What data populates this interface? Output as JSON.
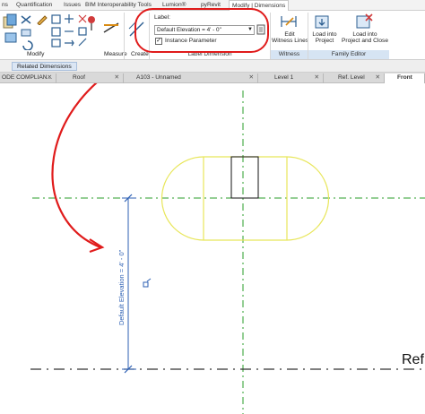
{
  "ribbon_tabs": [
    {
      "label": "ns"
    },
    {
      "label": "Quantification"
    },
    {
      "label": "Issues"
    },
    {
      "label": "BIM Interoperability Tools"
    },
    {
      "label": "Lumion®"
    },
    {
      "label": "pyRevit"
    },
    {
      "label": "Modify | Dimensions"
    }
  ],
  "ribbon": {
    "modify_label": "Modify",
    "measure_label": "Measure",
    "create_label": "Create",
    "label_caption": "Label:",
    "label_dimension_panel": "Label Dimension",
    "label_value": "Default Elevation = 4' - 0\"",
    "instance_parameter": "Instance Parameter",
    "edit_witness_line1": "Edit",
    "edit_witness_line2": "Witness Lines",
    "witness_lines_panel": "Witness Lines",
    "load_project_line1": "Load into",
    "load_project_line2": "Project",
    "load_close_line1": "Load into",
    "load_close_line2": "Project and Close",
    "family_editor_panel": "Family Editor",
    "check_mark": "✓"
  },
  "subbar": {
    "related_dimensions": "Related Dimensions"
  },
  "view_tabs": [
    {
      "label": "ODE COMPLIAN..."
    },
    {
      "label": "Roof"
    },
    {
      "label": "A103 - Unnamed"
    },
    {
      "label": "Level 1"
    },
    {
      "label": "Ref. Level"
    },
    {
      "label": "Front"
    }
  ],
  "view_tab_close": "✕",
  "canvas": {
    "dimension_text": "Default Elevation = 4' - 0\"",
    "ref_level_text": "Ref"
  },
  "colors": {
    "accent_red": "#e01b1b",
    "reference_green": "#2a9d2a",
    "outline_yellow": "#e8e65a",
    "dimension_blue": "#2c5fb3"
  }
}
